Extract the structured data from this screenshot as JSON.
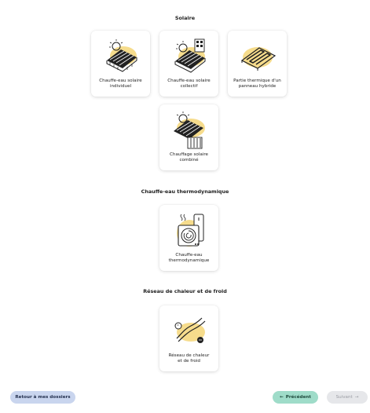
{
  "sections": {
    "solaire": {
      "title": "Solaire"
    },
    "thermo": {
      "title": "Chauffe-eau thermodynamique"
    },
    "reseau": {
      "title": "Réseau de chaleur et de froid"
    }
  },
  "cards": {
    "cesi": {
      "label": "Chauffe-eau solaire\nindividuel",
      "icon": "solar-water-heater-icon"
    },
    "cesc": {
      "label": "Chauffe-eau solaire\ncollectif",
      "icon": "collective-solar-water-heater-icon"
    },
    "hybride": {
      "label": "Partie thermique d'un\npanneau hybride",
      "icon": "hybrid-panel-icon"
    },
    "ssc": {
      "label": "Chauffage solaire\ncombiné",
      "icon": "combined-solar-heating-icon"
    },
    "thermo": {
      "label": "Chauffe-eau\nthermodynamique",
      "icon": "heat-pump-water-heater-icon"
    },
    "reseau": {
      "label": "Réseau de chaleur\net de froid",
      "icon": "heat-network-icon"
    }
  },
  "footer": {
    "back_label": "Retour à mes dossiers",
    "prev_label": "Précédent",
    "prev_arrow": "←",
    "next_label": "Suivant",
    "next_arrow": "→"
  },
  "colors": {
    "accent_yellow": "#f6dc8c",
    "back_button": "#c9d5ee",
    "prev_button": "#9fdcc9",
    "next_button_disabled": "#e6e7ea"
  }
}
